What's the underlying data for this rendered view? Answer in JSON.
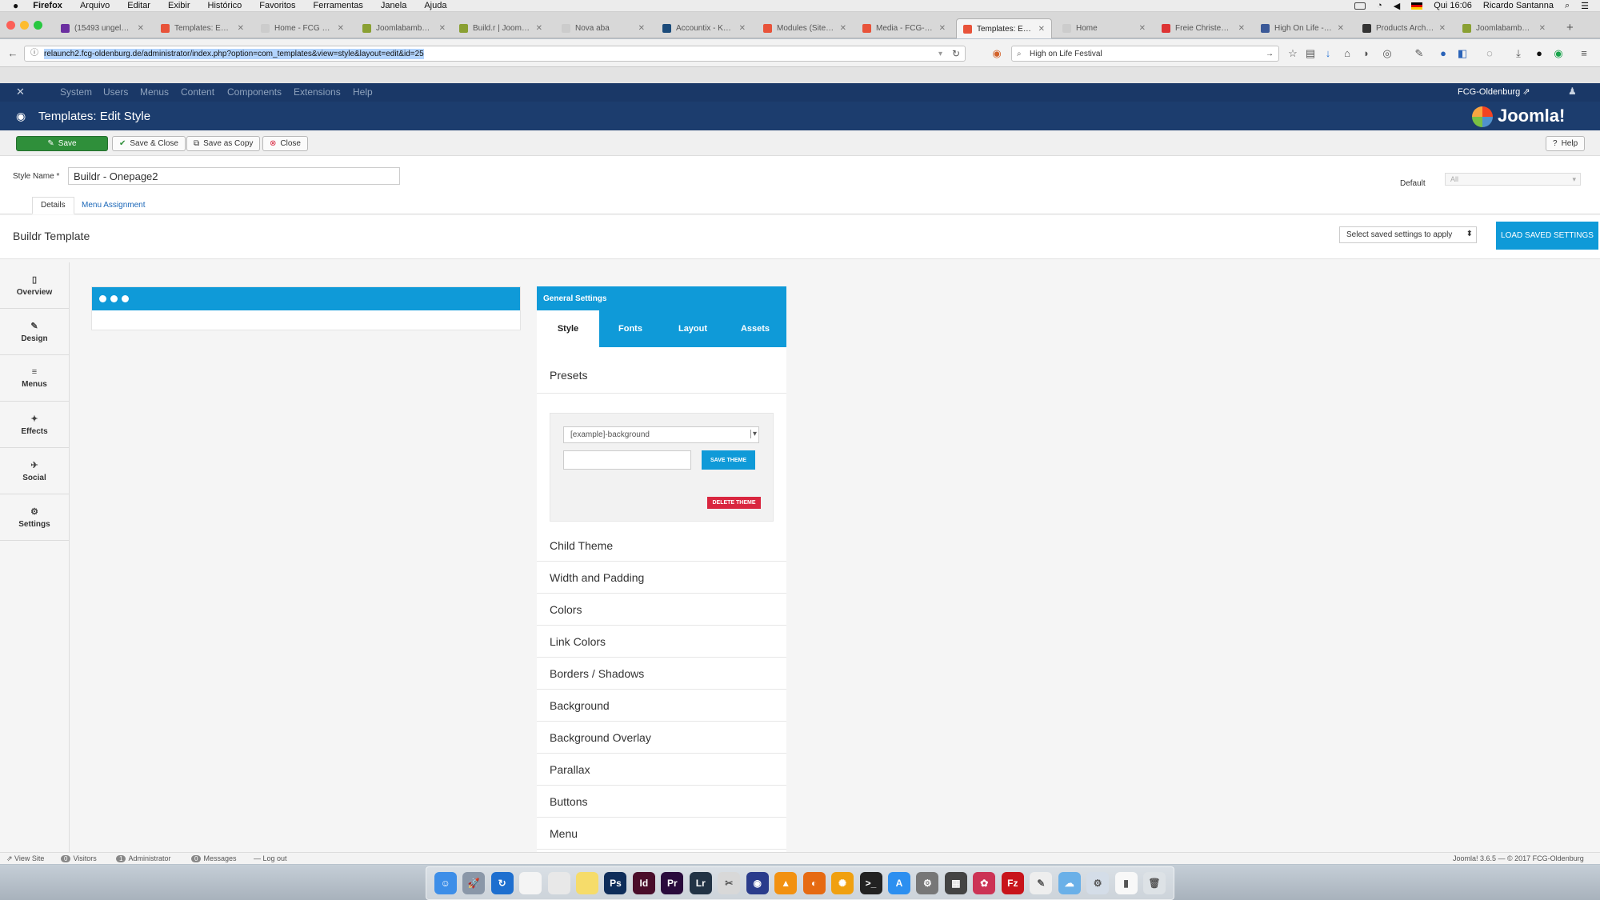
{
  "mac_menubar": {
    "app": "Firefox",
    "menus": [
      "Arquivo",
      "Editar",
      "Exibir",
      "Histórico",
      "Favoritos",
      "Ferramentas",
      "Janela",
      "Ajuda"
    ],
    "clock": "Qui 16:06",
    "user": "Ricardo Santanna"
  },
  "browser": {
    "tabs": [
      {
        "title": "(15493 ungelesen...",
        "color": "#6b2fa0"
      },
      {
        "title": "Templates: Edit S...",
        "color": "#e8533a"
      },
      {
        "title": "Home - FCG Oldenburg",
        "color": "#cccccc"
      },
      {
        "title": "Joomlabamboo S...",
        "color": "#8aa033"
      },
      {
        "title": "Build.r | Joomlaba...",
        "color": "#8aa033"
      },
      {
        "title": "Nova aba",
        "color": "#cccccc"
      },
      {
        "title": "Accountix - Kund...",
        "color": "#1b4b7a"
      },
      {
        "title": "Modules (Site) - F...",
        "color": "#e8533a"
      },
      {
        "title": "Media - FCG-Old...",
        "color": "#e8533a"
      },
      {
        "title": "Templates: Edit S...",
        "color": "#e8533a",
        "active": true
      },
      {
        "title": "Home",
        "color": "#cccccc"
      },
      {
        "title": "Freie Christenge...",
        "color": "#d33"
      },
      {
        "title": "High On Life - Ta...",
        "color": "#3b5998"
      },
      {
        "title": "Products Archive ...",
        "color": "#333333"
      },
      {
        "title": "Joomlabamboo S...",
        "color": "#8aa033"
      }
    ],
    "url": "relaunch2.fcg-oldenburg.de/administrator/index.php?option=com_templates&view=style&layout=edit&id=25",
    "search_value": "High on Life Festival"
  },
  "joomla": {
    "top_menu": [
      "System",
      "Users",
      "Menus",
      "Content",
      "Components",
      "Extensions",
      "Help"
    ],
    "site_link": "FCG-Oldenburg",
    "page_title": "Templates: Edit Style",
    "logo_text": "Joomla!",
    "toolbar": {
      "save": "Save",
      "save_close": "Save & Close",
      "save_copy": "Save as Copy",
      "close": "Close",
      "help": "Help"
    },
    "style_name_label": "Style Name *",
    "style_name_value": "Buildr - Onepage2",
    "default_label": "Default",
    "default_value": "All",
    "tabs": [
      "Details",
      "Menu Assignment"
    ],
    "template_title": "Buildr Template",
    "saved_settings_placeholder": "Select saved settings to apply",
    "load_saved_button": "LOAD SAVED SETTINGS",
    "sidebar": [
      {
        "label": "Overview",
        "icon": "book-icon"
      },
      {
        "label": "Design",
        "icon": "brush-icon"
      },
      {
        "label": "Menus",
        "icon": "menu-icon"
      },
      {
        "label": "Effects",
        "icon": "effects-icon"
      },
      {
        "label": "Social",
        "icon": "twitter-icon"
      },
      {
        "label": "Settings",
        "icon": "gear-icon"
      }
    ],
    "general_settings": {
      "title": "General Settings",
      "tabs": [
        "Style",
        "Fonts",
        "Layout",
        "Assets"
      ],
      "presets_title": "Presets",
      "preset_value": "[example]-background",
      "save_theme": "SAVE THEME",
      "delete_theme": "DELETE THEME",
      "sections": [
        "Child Theme",
        "Width and Padding",
        "Colors",
        "Link Colors",
        "Borders / Shadows",
        "Background",
        "Background Overlay",
        "Parallax",
        "Buttons",
        "Menu"
      ]
    },
    "statusbar": {
      "view_site": "View Site",
      "visitors_count": "0",
      "visitors": "Visitors",
      "admin_count": "1",
      "admin": "Administrator",
      "messages_count": "0",
      "messages": "Messages",
      "logout": "Log out",
      "version": "Joomla! 3.6.5  —  © 2017 FCG-Oldenburg"
    }
  },
  "colors": {
    "joomla_dark": "#1a3867",
    "joomla_header": "#1c3d6e",
    "accent_blue": "#0f9ad8",
    "save_green": "#2f8f3a",
    "delete_red": "#d9263f"
  },
  "dock": [
    {
      "name": "finder",
      "color": "#3d8ee8",
      "glyph": "☺"
    },
    {
      "name": "launchpad",
      "color": "#8a97a8",
      "glyph": "🚀"
    },
    {
      "name": "sync",
      "color": "#1e6fcf",
      "glyph": "↻"
    },
    {
      "name": "textedit",
      "color": "#f4f4f4",
      "glyph": ""
    },
    {
      "name": "script",
      "color": "#e8e8e8",
      "glyph": ""
    },
    {
      "name": "notes",
      "color": "#f6dc6a",
      "glyph": ""
    },
    {
      "name": "photoshop",
      "color": "#0e2d5a",
      "glyph": "Ps"
    },
    {
      "name": "indesign",
      "color": "#4a0d2a",
      "glyph": "Id"
    },
    {
      "name": "premiere",
      "color": "#2a0b3c",
      "glyph": "Pr"
    },
    {
      "name": "lightroom",
      "color": "#223345",
      "glyph": "Lr"
    },
    {
      "name": "scissors",
      "color": "#d8d8d8",
      "glyph": "✂"
    },
    {
      "name": "audio",
      "color": "#2a3c8c",
      "glyph": "◉"
    },
    {
      "name": "vlc",
      "color": "#f29111",
      "glyph": "▲"
    },
    {
      "name": "firefox",
      "color": "#e66a12",
      "glyph": "◐"
    },
    {
      "name": "sun",
      "color": "#f0a010",
      "glyph": "✺"
    },
    {
      "name": "terminal",
      "color": "#222222",
      "glyph": ">_"
    },
    {
      "name": "appstore",
      "color": "#2c8ff0",
      "glyph": "A"
    },
    {
      "name": "preferences",
      "color": "#777777",
      "glyph": "⚙"
    },
    {
      "name": "calculator",
      "color": "#444444",
      "glyph": "▦"
    },
    {
      "name": "colors",
      "color": "#cc3355",
      "glyph": "✿"
    },
    {
      "name": "filezilla",
      "color": "#c8141b",
      "glyph": "Fz"
    },
    {
      "name": "pdf",
      "color": "#eeeeee",
      "glyph": "✎"
    },
    {
      "name": "cloud",
      "color": "#6ab0e8",
      "glyph": "☁"
    },
    {
      "name": "finder2",
      "color": "#d4dde8",
      "glyph": "⚙"
    },
    {
      "name": "doc",
      "color": "#f8f8f8",
      "glyph": "▮"
    },
    {
      "name": "trash",
      "color": "#dde2e6",
      "glyph": "🗑"
    }
  ]
}
